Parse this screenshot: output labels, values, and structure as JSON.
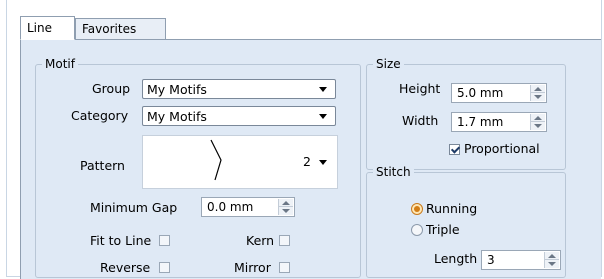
{
  "tabs": [
    {
      "label": "Line",
      "active": true
    },
    {
      "label": "Favorites",
      "active": false
    }
  ],
  "motif": {
    "title": "Motif",
    "group_label": "Group",
    "group_value": "My Motifs",
    "category_label": "Category",
    "category_value": "My Motifs",
    "pattern_label": "Pattern",
    "pattern_number": "2",
    "min_gap_label": "Minimum Gap",
    "min_gap_value": "0.0 mm",
    "fit_to_line_label": "Fit to Line",
    "fit_to_line_checked": false,
    "kern_label": "Kern",
    "kern_checked": false,
    "reverse_label": "Reverse",
    "reverse_checked": false,
    "mirror_label": "Mirror",
    "mirror_checked": false
  },
  "size": {
    "title": "Size",
    "height_label": "Height",
    "height_value": "5.0 mm",
    "width_label": "Width",
    "width_value": "1.7 mm",
    "proportional_label": "Proportional",
    "proportional_checked": true
  },
  "stitch": {
    "title": "Stitch",
    "running_label": "Running",
    "triple_label": "Triple",
    "selected": "Running",
    "length_label": "Length",
    "length_value": "3"
  },
  "colors": {
    "panel_bg": "#dfe9f5",
    "radio_selected": "#d27d16"
  }
}
